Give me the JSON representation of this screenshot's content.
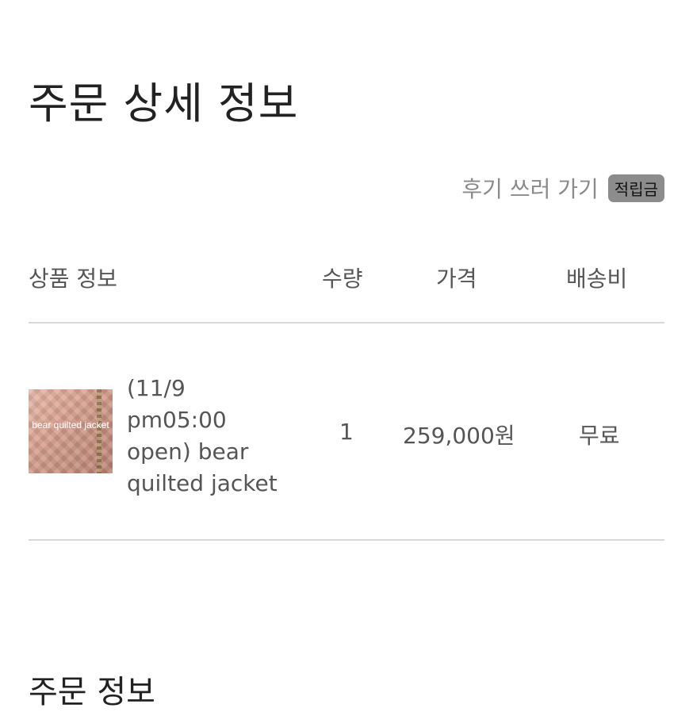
{
  "page": {
    "title": "주문 상세 정보",
    "review_link": "후기 쓰러 가기",
    "points_badge": "적립금"
  },
  "table": {
    "headers": {
      "product_info": "상품 정보",
      "quantity": "수량",
      "price": "가격",
      "shipping": "배송비"
    },
    "rows": [
      {
        "thumbnail_text": "bear quilted jacket",
        "product_name": "(11/9\npm05:00\nopen) bear\nquilted jacket",
        "quantity": "1",
        "price": "259,000원",
        "shipping": "무료"
      }
    ]
  },
  "order_info": {
    "title": "주문 정보"
  }
}
